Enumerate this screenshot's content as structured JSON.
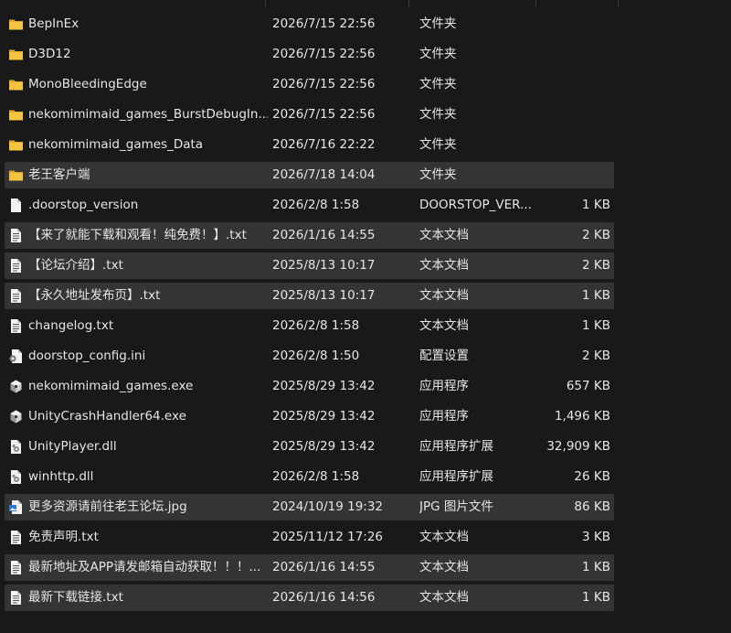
{
  "columns": {
    "name": "",
    "date": "",
    "type": "",
    "size": ""
  },
  "colors": {
    "background": "#191919",
    "row_selected": "#343434",
    "folder": "#f4c340",
    "text": "#e6e6e6"
  },
  "files": [
    {
      "name": "BepInEx",
      "date": "2026/7/15 22:56",
      "type": "文件夹",
      "size": "",
      "icon": "folder-icon",
      "selected": false
    },
    {
      "name": "D3D12",
      "date": "2026/7/15 22:56",
      "type": "文件夹",
      "size": "",
      "icon": "folder-icon",
      "selected": false
    },
    {
      "name": "MonoBleedingEdge",
      "date": "2026/7/15 22:56",
      "type": "文件夹",
      "size": "",
      "icon": "folder-icon",
      "selected": false
    },
    {
      "name": "nekomimimaid_games_BurstDebugIn...",
      "date": "2026/7/15 22:56",
      "type": "文件夹",
      "size": "",
      "icon": "folder-icon",
      "selected": false
    },
    {
      "name": "nekomimimaid_games_Data",
      "date": "2026/7/16 22:22",
      "type": "文件夹",
      "size": "",
      "icon": "folder-icon",
      "selected": false
    },
    {
      "name": "老王客户端",
      "date": "2026/7/18 14:04",
      "type": "文件夹",
      "size": "",
      "icon": "folder-icon",
      "selected": true
    },
    {
      "name": ".doorstop_version",
      "date": "2026/2/8 1:58",
      "type": "DOORSTOP_VER...",
      "size": "1 KB",
      "icon": "blank-file-icon",
      "selected": false
    },
    {
      "name": "【来了就能下载和观看！纯免费！】.txt",
      "date": "2026/1/16 14:55",
      "type": "文本文档",
      "size": "2 KB",
      "icon": "text-file-icon",
      "selected": true
    },
    {
      "name": "【论坛介绍】.txt",
      "date": "2025/8/13 10:17",
      "type": "文本文档",
      "size": "2 KB",
      "icon": "text-file-icon",
      "selected": true
    },
    {
      "name": "【永久地址发布页】.txt",
      "date": "2025/8/13 10:17",
      "type": "文本文档",
      "size": "1 KB",
      "icon": "text-file-icon",
      "selected": true
    },
    {
      "name": "changelog.txt",
      "date": "2026/2/8 1:58",
      "type": "文本文档",
      "size": "1 KB",
      "icon": "text-file-icon",
      "selected": false
    },
    {
      "name": "doorstop_config.ini",
      "date": "2026/2/8 1:50",
      "type": "配置设置",
      "size": "2 KB",
      "icon": "settings-file-icon",
      "selected": false
    },
    {
      "name": "nekomimimaid_games.exe",
      "date": "2025/8/29 13:42",
      "type": "应用程序",
      "size": "657 KB",
      "icon": "unity-exe-icon",
      "selected": false
    },
    {
      "name": "UnityCrashHandler64.exe",
      "date": "2025/8/29 13:42",
      "type": "应用程序",
      "size": "1,496 KB",
      "icon": "unity-exe-icon",
      "selected": false
    },
    {
      "name": "UnityPlayer.dll",
      "date": "2025/8/29 13:42",
      "type": "应用程序扩展",
      "size": "32,909 KB",
      "icon": "dll-file-icon",
      "selected": false
    },
    {
      "name": "winhttp.dll",
      "date": "2026/2/8 1:58",
      "type": "应用程序扩展",
      "size": "26 KB",
      "icon": "dll-file-icon",
      "selected": false
    },
    {
      "name": "更多资源请前往老王论坛.jpg",
      "date": "2024/10/19 19:32",
      "type": "JPG 图片文件",
      "size": "86 KB",
      "icon": "image-file-icon",
      "selected": true
    },
    {
      "name": "免责声明.txt",
      "date": "2025/11/12 17:26",
      "type": "文本文档",
      "size": "3 KB",
      "icon": "text-file-icon",
      "selected": false
    },
    {
      "name": "最新地址及APP请发邮箱自动获取！！！...",
      "date": "2026/1/16 14:55",
      "type": "文本文档",
      "size": "1 KB",
      "icon": "text-file-icon",
      "selected": true
    },
    {
      "name": "最新下载链接.txt",
      "date": "2026/1/16 14:56",
      "type": "文本文档",
      "size": "1 KB",
      "icon": "text-file-icon",
      "selected": true
    }
  ]
}
